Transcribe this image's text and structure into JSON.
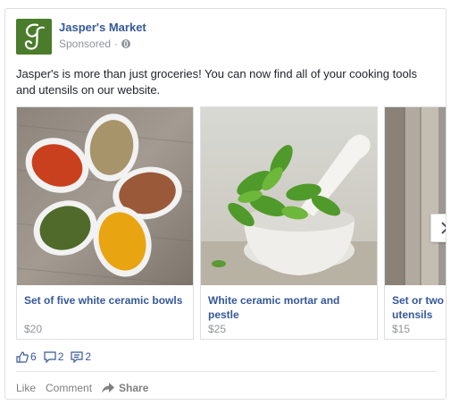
{
  "post": {
    "page_name": "Jasper's Market",
    "sponsored_label": "Sponsored",
    "separator": "·",
    "text": "Jasper's is more than just groceries! You can now find all of your cooking tools and utensils on our website.",
    "brand_color": "#4a7c2b",
    "link_color": "#365899"
  },
  "carousel": {
    "items": [
      {
        "title": "Set of five white ceramic bowls",
        "price": "$20",
        "image": "spices-in-white-ceramic-bowls"
      },
      {
        "title": "White ceramic mortar and pestle",
        "price": "$25",
        "image": "mortar-and-pestle-with-herbs"
      },
      {
        "title": "Set or two w",
        "title_line2": "utensils",
        "price": "$15",
        "image": "wooden-utensils"
      }
    ],
    "next_icon": "chevron-right-icon"
  },
  "stats": {
    "likes": "6",
    "comments": "2",
    "shares": "2"
  },
  "actions": {
    "like": "Like",
    "comment": "Comment",
    "share": "Share"
  }
}
